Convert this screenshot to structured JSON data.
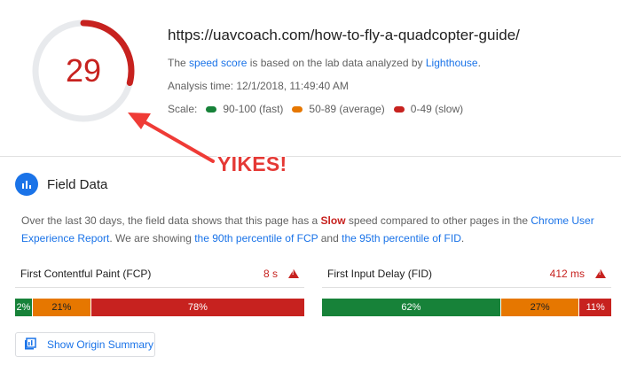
{
  "score": {
    "value": "29",
    "fraction": 0.29,
    "color": "#c7221f"
  },
  "summary": {
    "url": "https://uavcoach.com/how-to-fly-a-quadcopter-guide/",
    "desc_prefix": "The ",
    "desc_link1": "speed score",
    "desc_mid": " is based on the lab data analyzed by ",
    "desc_link2": "Lighthouse",
    "desc_suffix": ".",
    "analysis_time": "Analysis time: 12/1/2018, 11:49:40 AM",
    "scale_label": "Scale:",
    "scale": [
      {
        "label": "90-100 (fast)",
        "color": "#178239"
      },
      {
        "label": "50-89 (average)",
        "color": "#e67700"
      },
      {
        "label": "0-49 (slow)",
        "color": "#c7221f"
      }
    ]
  },
  "annotation": {
    "text": "YIKES!"
  },
  "field_data": {
    "title": "Field Data",
    "desc_part1": "Over the last 30 days, the field data shows that this page has a ",
    "desc_slow": "Slow",
    "desc_part2": " speed compared to other pages in the ",
    "desc_link1": "Chrome User Experience Report",
    "desc_part3": ". We are showing ",
    "desc_link2": "the 90th percentile of FCP",
    "desc_part4": " and ",
    "desc_link3": "the 95th percentile of FID",
    "desc_part5": "."
  },
  "metrics": {
    "fcp": {
      "label": "First Contentful Paint (FCP)",
      "value": "8 s",
      "distribution": [
        {
          "label": "2%",
          "share": 2,
          "category": "fast"
        },
        {
          "label": "21%",
          "share": 21,
          "category": "average"
        },
        {
          "label": "78%",
          "share": 78,
          "category": "slow"
        }
      ]
    },
    "fid": {
      "label": "First Input Delay (FID)",
      "value": "412 ms",
      "distribution": [
        {
          "label": "62%",
          "share": 62,
          "category": "fast"
        },
        {
          "label": "27%",
          "share": 27,
          "category": "average"
        },
        {
          "label": "11%",
          "share": 11,
          "category": "slow"
        }
      ]
    }
  },
  "buttons": {
    "origin_summary": "Show Origin Summary"
  }
}
